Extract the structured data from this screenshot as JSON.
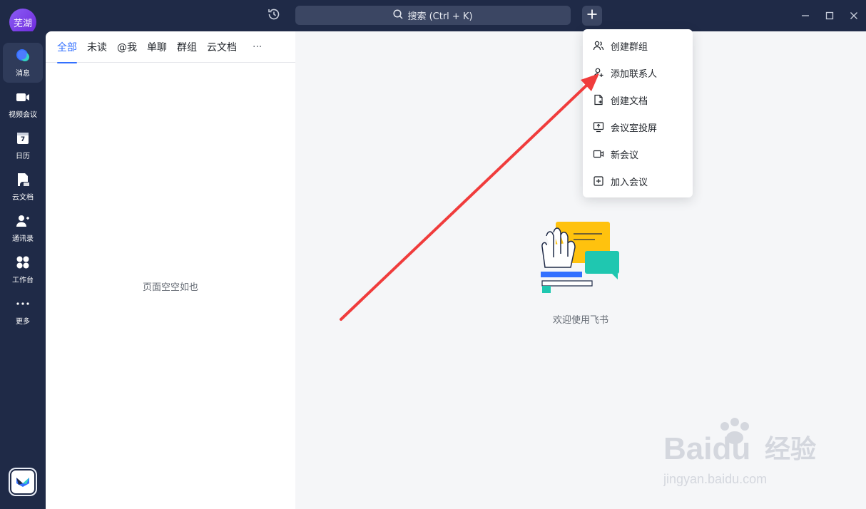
{
  "titlebar": {
    "avatar_text": "芜湖",
    "search_placeholder": "搜索 (Ctrl + K)"
  },
  "nav": {
    "items": [
      {
        "label": "消息",
        "icon": "message-icon",
        "active": true
      },
      {
        "label": "视频会议",
        "icon": "video-icon",
        "active": false
      },
      {
        "label": "日历",
        "icon": "calendar-icon",
        "active": false,
        "badge": "7"
      },
      {
        "label": "云文档",
        "icon": "cloud-doc-icon",
        "active": false
      },
      {
        "label": "通讯录",
        "icon": "contacts-icon",
        "active": false
      },
      {
        "label": "工作台",
        "icon": "workplace-icon",
        "active": false
      },
      {
        "label": "更多",
        "icon": "more-icon",
        "active": false
      }
    ]
  },
  "tabs": [
    "全部",
    "未读",
    "@我",
    "单聊",
    "群组",
    "云文档",
    "···"
  ],
  "list": {
    "empty_text": "页面空空如也"
  },
  "main": {
    "welcome_text": "欢迎使用飞书"
  },
  "menu": {
    "items": [
      {
        "label": "创建群组",
        "icon": "group-icon"
      },
      {
        "label": "添加联系人",
        "icon": "add-contact-icon"
      },
      {
        "label": "创建文档",
        "icon": "new-doc-icon"
      },
      {
        "label": "会议室投屏",
        "icon": "screen-share-icon"
      },
      {
        "label": "新会议",
        "icon": "video-camera-icon"
      },
      {
        "label": "加入会议",
        "icon": "join-meeting-icon"
      }
    ]
  },
  "colors": {
    "sidebar": "#1f2a47",
    "accent": "#3370ff",
    "arrow": "#f03c3c"
  },
  "watermark": {
    "brand": "Baidu",
    "suffix": "经验",
    "url": "jingyan.baidu.com"
  }
}
